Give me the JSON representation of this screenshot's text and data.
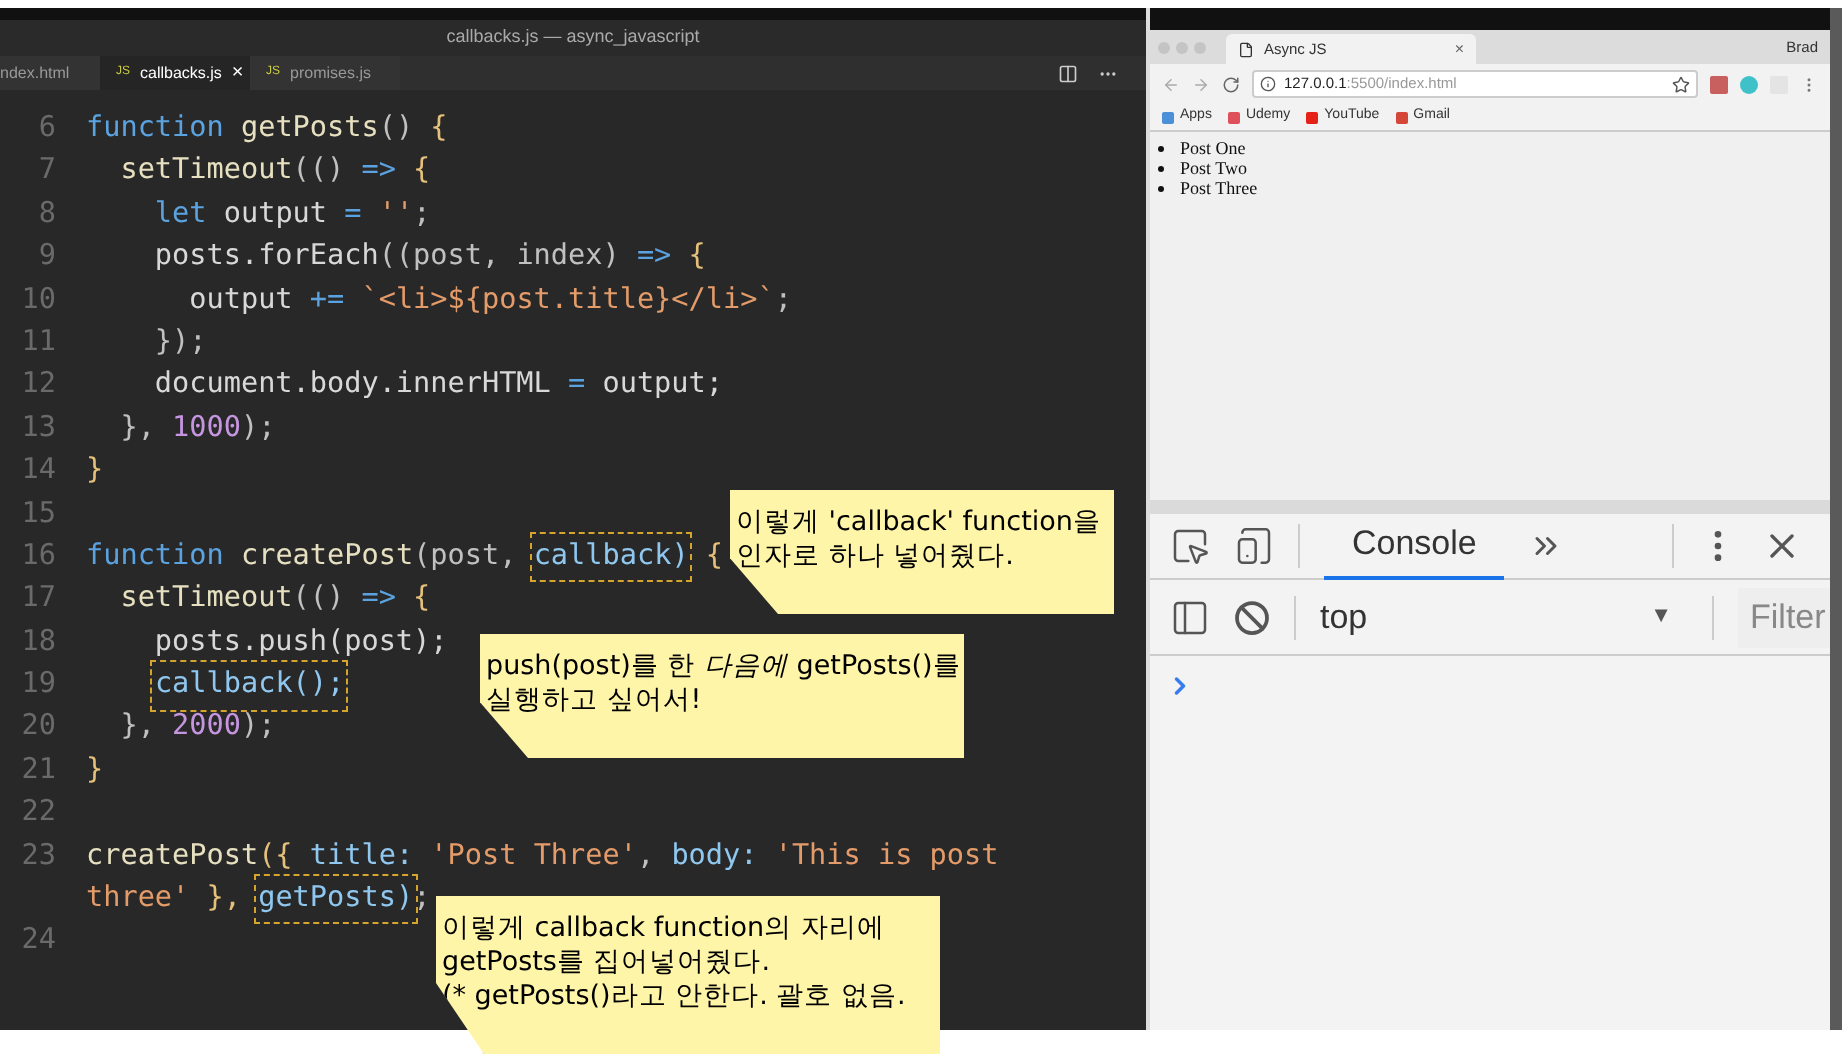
{
  "editor": {
    "title": "callbacks.js — async_javascript",
    "tabs": [
      {
        "label": "ndex.html",
        "selected": false
      },
      {
        "badge": "JS",
        "label": "callbacks.js",
        "selected": true,
        "close": "×"
      },
      {
        "badge": "JS",
        "label": "promises.js",
        "selected": false
      }
    ],
    "lines": [
      {
        "number": "6",
        "tokens": [
          {
            "t": "function",
            "kind": "kw"
          },
          {
            "t": " getPosts",
            "kind": "fn"
          },
          {
            "t": "() ",
            "kind": "punct"
          },
          {
            "t": "{",
            "kind": "brace"
          }
        ]
      },
      {
        "number": "7",
        "tokens": [
          {
            "t": "  setTimeout",
            "kind": "fn"
          },
          {
            "t": "(() ",
            "kind": "punct"
          },
          {
            "t": "=>",
            "kind": "kw"
          },
          {
            "t": " {",
            "kind": "brace"
          }
        ]
      },
      {
        "number": "8",
        "tokens": [
          {
            "t": "    let",
            "kind": "kw"
          },
          {
            "t": " output ",
            "kind": "var"
          },
          {
            "t": "=",
            "kind": "kw"
          },
          {
            "t": " ''",
            "kind": "str"
          },
          {
            "t": ";",
            "kind": "punct"
          }
        ]
      },
      {
        "number": "9",
        "tokens": [
          {
            "t": "    posts.forEach",
            "kind": "var"
          },
          {
            "t": "((post, index) ",
            "kind": "punct"
          },
          {
            "t": "=>",
            "kind": "kw"
          },
          {
            "t": " {",
            "kind": "brace"
          }
        ]
      },
      {
        "number": "10",
        "tokens": [
          {
            "t": "      output ",
            "kind": "var"
          },
          {
            "t": "+=",
            "kind": "kw"
          },
          {
            "t": " `<li>${post.title}</li>`",
            "kind": "str"
          },
          {
            "t": ";",
            "kind": "punct"
          }
        ]
      },
      {
        "number": "11",
        "tokens": [
          {
            "t": "    });",
            "kind": "punct"
          }
        ]
      },
      {
        "number": "12",
        "tokens": [
          {
            "t": "    document.body.innerHTML ",
            "kind": "var"
          },
          {
            "t": "=",
            "kind": "kw"
          },
          {
            "t": " output;",
            "kind": "var"
          }
        ]
      },
      {
        "number": "13",
        "tokens": [
          {
            "t": "  }, ",
            "kind": "punct"
          },
          {
            "t": "1000",
            "kind": "num"
          },
          {
            "t": ");",
            "kind": "punct"
          }
        ]
      },
      {
        "number": "14",
        "tokens": [
          {
            "t": "}",
            "kind": "brace"
          }
        ]
      },
      {
        "number": "15"
      },
      {
        "number": "16",
        "tokens": [
          {
            "t": "function",
            "kind": "kw"
          },
          {
            "t": " createPost",
            "kind": "fn"
          },
          {
            "t": "(post, ",
            "kind": "punct"
          },
          {
            "t": "callback)",
            "kind": "param",
            "boxed": true
          },
          {
            "t": " {",
            "kind": "brace"
          }
        ]
      },
      {
        "number": "17",
        "tokens": [
          {
            "t": "  setTimeout",
            "kind": "fn"
          },
          {
            "t": "(() ",
            "kind": "punct"
          },
          {
            "t": "=>",
            "kind": "kw"
          },
          {
            "t": " {",
            "kind": "brace"
          }
        ]
      },
      {
        "number": "18",
        "tokens": [
          {
            "t": "    posts.push(post);",
            "kind": "var"
          }
        ]
      },
      {
        "number": "19",
        "indent": true,
        "tokens": [
          {
            "t": "callback();",
            "kind": "param",
            "boxed": true
          }
        ]
      },
      {
        "number": "20",
        "tokens": [
          {
            "t": "  }, ",
            "kind": "punct"
          },
          {
            "t": "2000",
            "kind": "num"
          },
          {
            "t": ");",
            "kind": "punct"
          }
        ]
      },
      {
        "number": "21",
        "tokens": [
          {
            "t": "}",
            "kind": "brace"
          }
        ]
      },
      {
        "number": "22"
      },
      {
        "number": "23",
        "tokens": [
          {
            "t": "createPost",
            "kind": "fn"
          },
          {
            "t": "({ ",
            "kind": "brace"
          },
          {
            "t": "title:",
            "kind": "param"
          },
          {
            "t": " 'Post Three'",
            "kind": "str"
          },
          {
            "t": ", ",
            "kind": "punct"
          },
          {
            "t": "body:",
            "kind": "param"
          },
          {
            "t": " 'This is post",
            "kind": "str"
          }
        ]
      },
      {
        "tokens": [
          {
            "t": "three'",
            "kind": "str"
          },
          {
            "t": " }, ",
            "kind": "brace"
          },
          {
            "t": "getPosts)",
            "kind": "param",
            "boxed": true
          },
          {
            "t": ";",
            "kind": "punct"
          }
        ]
      },
      {
        "number": "24"
      }
    ]
  },
  "browser": {
    "tab": {
      "title": "Async JS",
      "close": "×"
    },
    "profile": "Brad",
    "url_host": "127.0.0.1",
    "url_rest": ":5500/index.html",
    "bookmarks": [
      {
        "label": "Apps",
        "color": "#4a8fd8"
      },
      {
        "label": "Udemy",
        "color": "#e0505a"
      },
      {
        "label": "YouTube",
        "color": "#e62117"
      },
      {
        "label": "Gmail",
        "color": "#d44638"
      }
    ],
    "page_items": [
      "Post One",
      "Post Two",
      "Post Three"
    ],
    "devtools": {
      "tabs": [
        {
          "label": "Console",
          "selected": true
        }
      ],
      "context": "top",
      "dropdown": "▼",
      "filter_placeholder": "Filter"
    }
  },
  "notes": [
    {
      "lines": [
        "이렇게 'callback' function을",
        "인자로 하나 넣어줬다."
      ]
    },
    {
      "lines": [
        "push(post)를 한 *다음에* getPosts()를",
        "실행하고 싶어서!"
      ]
    },
    {
      "lines": [
        "이렇게 callback function의 자리에",
        "getPosts를 집어넣어줬다.",
        "(* getPosts()라고 안한다. 괄호 없음."
      ]
    }
  ]
}
